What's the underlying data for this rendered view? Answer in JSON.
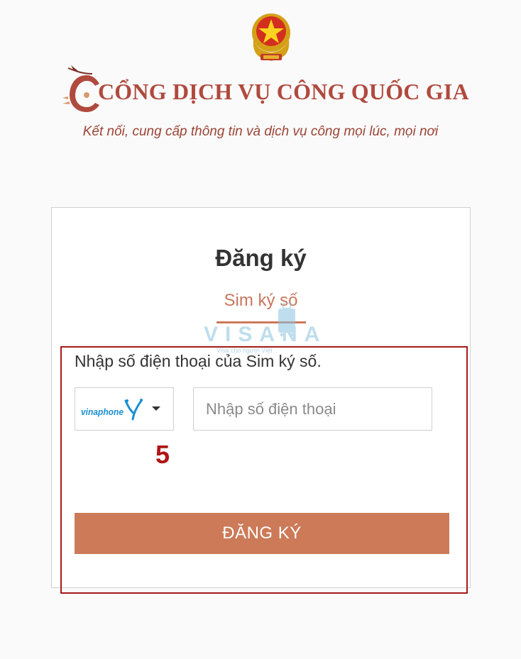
{
  "header": {
    "site_title": "CỔNG DỊCH VỤ CÔNG QUỐC GIA",
    "tagline": "Kết nối, cung cấp thông tin và dịch vụ công mọi lúc, mọi nơi"
  },
  "form": {
    "title": "Đăng ký",
    "active_tab": "Sim ký số",
    "instruction": "Nhập số điện thoại của Sim ký số.",
    "carrier": {
      "selected": "vinaphone",
      "icon": "vinaphone-logo"
    },
    "phone_placeholder": "Nhập số điện thoại",
    "phone_value": "",
    "submit_label": "ĐĂNG KÝ"
  },
  "annotation": {
    "step_number": "5"
  },
  "watermark": {
    "text": "VISANA",
    "subtext": "Visa cho người Việt"
  },
  "colors": {
    "brand_red": "#b04a3e",
    "accent": "#cc7a58",
    "highlight_border": "#a51b1b",
    "step_number": "#b01515"
  }
}
